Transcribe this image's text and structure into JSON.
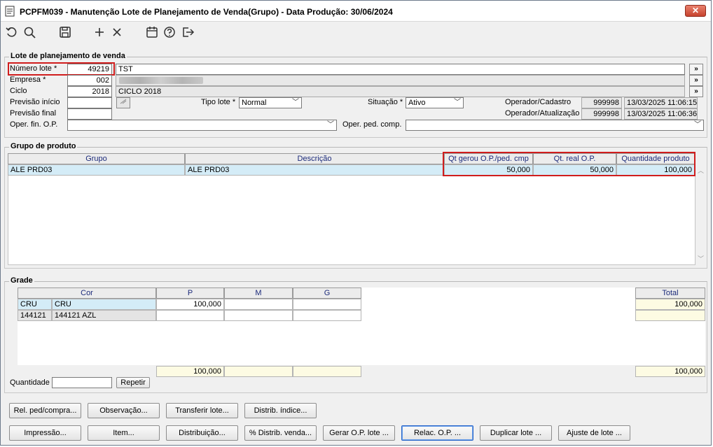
{
  "window": {
    "title": "PCPFM039 - Manutenção Lote de Planejamento de Venda(Grupo) - Data Produção: 30/06/2024",
    "close_label": "✕"
  },
  "toolbar": {
    "icons": [
      "undo-icon",
      "search-icon",
      "save-icon",
      "add-icon",
      "delete-icon",
      "calendar-icon",
      "help-icon",
      "exit-icon"
    ]
  },
  "lote": {
    "legend": "Lote de planejamento de venda",
    "numero_label": "Número lote *",
    "numero_value": "49219",
    "numero_desc": "TST",
    "empresa_label": "Empresa *",
    "empresa_value": "002",
    "ciclo_label": "Ciclo",
    "ciclo_value": "2018",
    "ciclo_desc": "CICLO 2018",
    "prev_inicio_label": "Previsão início",
    "prev_inicio_value": "",
    "prev_final_label": "Previsão final",
    "prev_final_value": "",
    "oper_fin_label": "Oper. fin. O.P.",
    "oper_fin_value": "",
    "tipo_lote_label": "Tipo lote *",
    "tipo_lote_value": "Normal",
    "situacao_label": "Situação *",
    "situacao_value": "Ativo",
    "oper_ped_label": "Oper. ped. comp.",
    "oper_ped_value": "",
    "operador_cadastro_label": "Operador/Cadastro",
    "operador_cadastro_value": "999998",
    "operador_cadastro_date": "13/03/2025 11:06:15",
    "operador_atualizacao_label": "Operador/Atualização",
    "operador_atualizacao_value": "999998",
    "operador_atualizacao_date": "13/03/2025 11:06:36",
    "more_label": "»"
  },
  "grupo": {
    "legend": "Grupo de produto",
    "columns": [
      "Grupo",
      "Descrição",
      "Qt gerou O.P./ped. cmp",
      "Qt. real O.P.",
      "Quantidade produto"
    ],
    "rows": [
      {
        "grupo": "ALE PRD03",
        "descricao": "ALE PRD03",
        "qt_gerou": "50,000",
        "qt_real": "50,000",
        "qtd_produto": "100,000"
      }
    ]
  },
  "grade": {
    "legend": "Grade",
    "columns": [
      "Cor",
      "P",
      "M",
      "G"
    ],
    "total_header": "Total",
    "rows": [
      {
        "code": "CRU",
        "name": "CRU",
        "p": "100,000",
        "m": "",
        "g": "",
        "total": "100,000"
      },
      {
        "code": "144121",
        "name": "144121 AZL",
        "p": "",
        "m": "",
        "g": "",
        "total": ""
      }
    ],
    "sum_p": "100,000",
    "sum_m": "",
    "sum_g": "",
    "sum_total": "100,000",
    "quantidade_label": "Quantidade",
    "quantidade_value": "",
    "repetir_label": "Repetir"
  },
  "buttons": {
    "rel_ped": "Rel. ped/compra...",
    "observacao": "Observação...",
    "transferir": "Transferir lote...",
    "distrib_indice": "Distrib. índice...",
    "impressao": "Impressão...",
    "item": "Item...",
    "distribuicao": "Distribuição...",
    "pct_distrib": "% Distrib. venda...",
    "gerar_op": "Gerar O.P. lote ...",
    "relac_op": "Relac. O.P. ...",
    "duplicar": "Duplicar lote ...",
    "ajuste": "Ajuste de lote ..."
  }
}
